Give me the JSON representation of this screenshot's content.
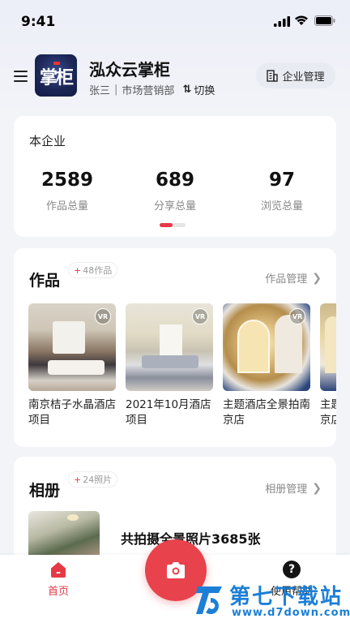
{
  "status_bar": {
    "time": "9:41"
  },
  "header": {
    "logo_text": "掌柜",
    "app_title": "泓众云掌柜",
    "user_name": "张三",
    "separator": "|",
    "department": "市场营销部",
    "switch_icon": "⇅",
    "switch_label": "切换",
    "enterprise_button": "企业管理"
  },
  "stats": {
    "title": "本企业",
    "items": [
      {
        "value": "2589",
        "label": "作品总量"
      },
      {
        "value": "689",
        "label": "分享总量"
      },
      {
        "value": "97",
        "label": "浏览总量"
      }
    ],
    "pager": {
      "pages": 2,
      "active": 1
    }
  },
  "works": {
    "title": "作品",
    "tag_plus": "+",
    "tag": "48作品",
    "manage": "作品管理",
    "items": [
      {
        "caption": "南京桔子水晶酒店项目"
      },
      {
        "caption": "2021年10月酒店项目"
      },
      {
        "caption": "主题酒店全景拍南京店"
      },
      {
        "caption": "主题酒店全景拍南京店"
      }
    ],
    "pano_badge": "VR"
  },
  "album": {
    "title": "相册",
    "tag_plus": "+",
    "tag": "24照片",
    "manage": "相册管理",
    "summary": "共拍摄全景照片3685张"
  },
  "bottom_nav": {
    "home_label": "首页",
    "help_label": "使用帮助",
    "help_glyph": "?"
  },
  "watermark": {
    "title": "第七下载站",
    "url": "www.d7down.com"
  },
  "colors": {
    "accent": "#e53946",
    "camera": "#e8424d",
    "watermark": "#1c7fd6"
  },
  "icons": [
    "menu-icon",
    "building-icon",
    "switch-icon",
    "chevron-right-icon",
    "pano-icon",
    "camera-icon",
    "home-icon",
    "help-icon"
  ]
}
